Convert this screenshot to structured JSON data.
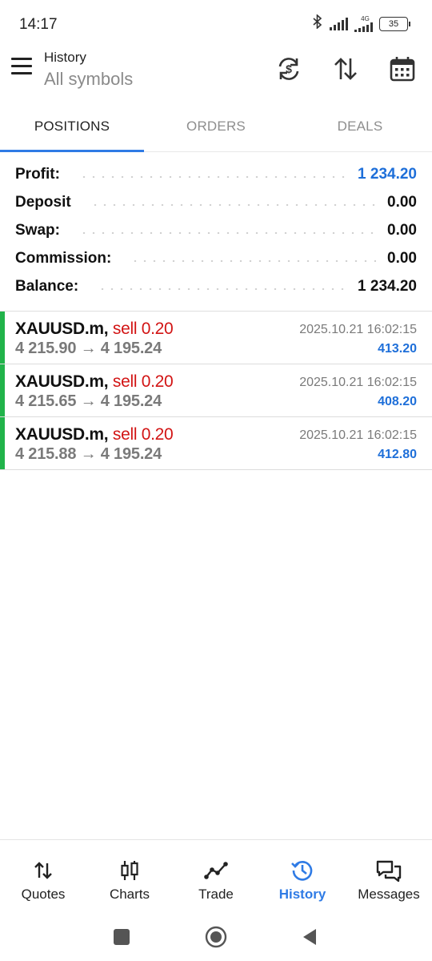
{
  "status_bar": {
    "time": "14:17",
    "network": "4G",
    "battery": "35"
  },
  "app_bar": {
    "title": "History",
    "subtitle": "All symbols",
    "actions": [
      "currency-exchange-icon",
      "sort-icon",
      "calendar-icon"
    ]
  },
  "tabs": [
    {
      "label": "POSITIONS",
      "active": true
    },
    {
      "label": "ORDERS",
      "active": false
    },
    {
      "label": "DEALS",
      "active": false
    }
  ],
  "summary": [
    {
      "label": "Profit:",
      "value": "1 234.20",
      "highlight": true
    },
    {
      "label": "Deposit",
      "value": "0.00",
      "highlight": false
    },
    {
      "label": "Swap:",
      "value": "0.00",
      "highlight": false
    },
    {
      "label": "Commission:",
      "value": "0.00",
      "highlight": false
    },
    {
      "label": "Balance:",
      "value": "1 234.20",
      "highlight": false
    }
  ],
  "positions": [
    {
      "symbol": "XAUUSD.m,",
      "side": "sell 0.20",
      "prices": "4 215.90 → 4 195.24",
      "time": "2025.10.21 16:02:15",
      "profit": "413.20"
    },
    {
      "symbol": "XAUUSD.m,",
      "side": "sell 0.20",
      "prices": "4 215.65 → 4 195.24",
      "time": "2025.10.21 16:02:15",
      "profit": "408.20"
    },
    {
      "symbol": "XAUUSD.m,",
      "side": "sell 0.20",
      "prices": "4 215.88 → 4 195.24",
      "time": "2025.10.21 16:02:15",
      "profit": "412.80"
    }
  ],
  "bottom_nav": [
    {
      "label": "Quotes",
      "icon": "quotes-icon",
      "active": false
    },
    {
      "label": "Charts",
      "icon": "charts-icon",
      "active": false
    },
    {
      "label": "Trade",
      "icon": "trade-icon",
      "active": false
    },
    {
      "label": "History",
      "icon": "history-icon",
      "active": true
    },
    {
      "label": "Messages",
      "icon": "messages-icon",
      "active": false
    }
  ],
  "colors": {
    "accent": "#2f7be5",
    "profit_blue": "#1e6fd9",
    "sell_red": "#d21414",
    "position_bar": "#21b34a"
  }
}
